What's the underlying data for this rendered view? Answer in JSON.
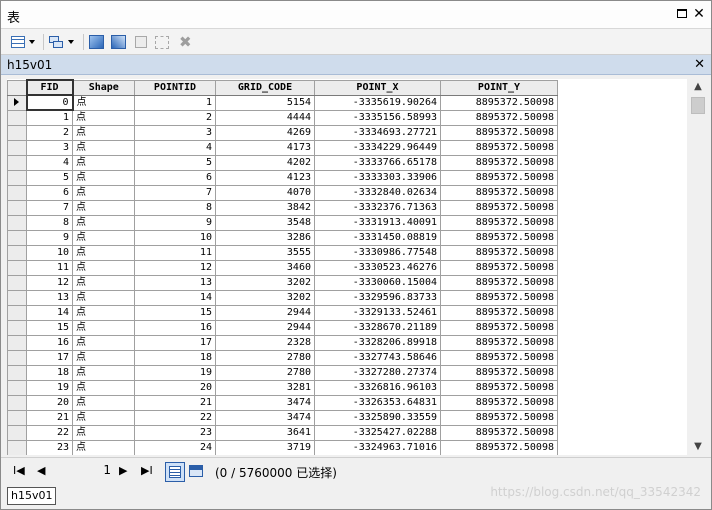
{
  "window": {
    "title": "表",
    "maximize_icon": "maximize-icon",
    "close_glyph": "✕"
  },
  "toolbar": {
    "icons": [
      "table-options-icon",
      "related-tables-icon",
      "select-by-attributes-icon",
      "switch-selection-icon",
      "clear-selection-icon",
      "delete-selected-icon",
      "delete-icon"
    ]
  },
  "tab": {
    "title": "h15v01",
    "close_glyph": "✕"
  },
  "table": {
    "columns": [
      "FID",
      "Shape",
      "POINTID",
      "GRID_CODE",
      "POINT_X",
      "POINT_Y"
    ],
    "rows": [
      [
        "0",
        "点",
        "1",
        "5154",
        "-3335619.90264",
        "8895372.50098"
      ],
      [
        "1",
        "点",
        "2",
        "4444",
        "-3335156.58993",
        "8895372.50098"
      ],
      [
        "2",
        "点",
        "3",
        "4269",
        "-3334693.27721",
        "8895372.50098"
      ],
      [
        "3",
        "点",
        "4",
        "4173",
        "-3334229.96449",
        "8895372.50098"
      ],
      [
        "4",
        "点",
        "5",
        "4202",
        "-3333766.65178",
        "8895372.50098"
      ],
      [
        "5",
        "点",
        "6",
        "4123",
        "-3333303.33906",
        "8895372.50098"
      ],
      [
        "6",
        "点",
        "7",
        "4070",
        "-3332840.02634",
        "8895372.50098"
      ],
      [
        "7",
        "点",
        "8",
        "3842",
        "-3332376.71363",
        "8895372.50098"
      ],
      [
        "8",
        "点",
        "9",
        "3548",
        "-3331913.40091",
        "8895372.50098"
      ],
      [
        "9",
        "点",
        "10",
        "3286",
        "-3331450.08819",
        "8895372.50098"
      ],
      [
        "10",
        "点",
        "11",
        "3555",
        "-3330986.77548",
        "8895372.50098"
      ],
      [
        "11",
        "点",
        "12",
        "3460",
        "-3330523.46276",
        "8895372.50098"
      ],
      [
        "12",
        "点",
        "13",
        "3202",
        "-3330060.15004",
        "8895372.50098"
      ],
      [
        "13",
        "点",
        "14",
        "3202",
        "-3329596.83733",
        "8895372.50098"
      ],
      [
        "14",
        "点",
        "15",
        "2944",
        "-3329133.52461",
        "8895372.50098"
      ],
      [
        "15",
        "点",
        "16",
        "2944",
        "-3328670.21189",
        "8895372.50098"
      ],
      [
        "16",
        "点",
        "17",
        "2328",
        "-3328206.89918",
        "8895372.50098"
      ],
      [
        "17",
        "点",
        "18",
        "2780",
        "-3327743.58646",
        "8895372.50098"
      ],
      [
        "18",
        "点",
        "19",
        "2780",
        "-3327280.27374",
        "8895372.50098"
      ],
      [
        "19",
        "点",
        "20",
        "3281",
        "-3326816.96103",
        "8895372.50098"
      ],
      [
        "20",
        "点",
        "21",
        "3474",
        "-3326353.64831",
        "8895372.50098"
      ],
      [
        "21",
        "点",
        "22",
        "3474",
        "-3325890.33559",
        "8895372.50098"
      ],
      [
        "22",
        "点",
        "23",
        "3641",
        "-3325427.02288",
        "8895372.50098"
      ],
      [
        "23",
        "点",
        "24",
        "3719",
        "-3324963.71016",
        "8895372.50098"
      ]
    ],
    "current_row": 0
  },
  "statusbar": {
    "first_glyph": "I◀",
    "prev_glyph": "◀",
    "record_number": "1",
    "next_glyph": "▶",
    "last_glyph": "▶I",
    "selection_status": "(0 / 5760000 已选择)"
  },
  "bottom_tab": {
    "label": "h15v01"
  },
  "watermark": "https://blog.csdn.net/qq_33542342",
  "colors": {
    "tab_bar": "#cfdcec",
    "header_bg": "#ececec",
    "accent": "#2b5ea8"
  }
}
